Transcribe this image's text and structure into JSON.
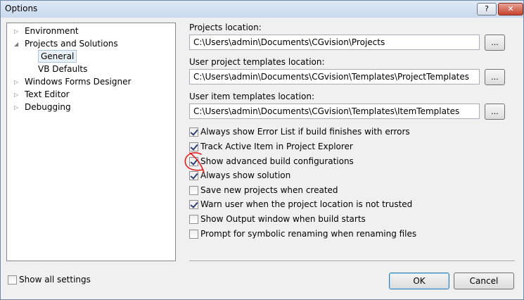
{
  "window": {
    "title": "Options",
    "help_label": "?",
    "close_label": "✕"
  },
  "tree": {
    "items": [
      {
        "label": "Environment",
        "expander": "collapsed"
      },
      {
        "label": "Projects and Solutions",
        "expander": "expanded"
      },
      {
        "label": "General",
        "selected": true
      },
      {
        "label": "VB Defaults"
      },
      {
        "label": "Windows Forms Designer",
        "expander": "collapsed"
      },
      {
        "label": "Text Editor",
        "expander": "collapsed"
      },
      {
        "label": "Debugging",
        "expander": "collapsed"
      }
    ],
    "expander_glyphs": {
      "collapsed": "▷",
      "expanded": "◢"
    }
  },
  "fields": {
    "projects": {
      "label": "Projects location:",
      "value": "C:\\Users\\admin\\Documents\\CGvision\\Projects"
    },
    "project_templates": {
      "label": "User project templates location:",
      "value": "C:\\Users\\admin\\Documents\\CGvision\\Templates\\ProjectTemplates"
    },
    "item_templates": {
      "label": "User item templates location:",
      "value": "C:\\Users\\admin\\Documents\\CGvision\\Templates\\ItemTemplates"
    },
    "browse_label": "..."
  },
  "options": [
    {
      "label": "Always show Error List if build finishes with errors",
      "checked": true
    },
    {
      "label": "Track Active Item in Project Explorer",
      "checked": true
    },
    {
      "label": "Show advanced build configurations",
      "checked": true
    },
    {
      "label": "Always show solution",
      "checked": true
    },
    {
      "label": "Save new projects when created",
      "checked": false
    },
    {
      "label": "Warn user when the project location is not trusted",
      "checked": true
    },
    {
      "label": "Show Output window when build starts",
      "checked": false
    },
    {
      "label": "Prompt for symbolic renaming when renaming files",
      "checked": false
    }
  ],
  "footer": {
    "show_all_label": "Show all settings",
    "show_all_checked": false,
    "ok_label": "OK",
    "cancel_label": "Cancel"
  },
  "colors": {
    "annotation": "#e02020",
    "checkmark": "#2b3e6e",
    "selection_border": "#aec3dd"
  }
}
